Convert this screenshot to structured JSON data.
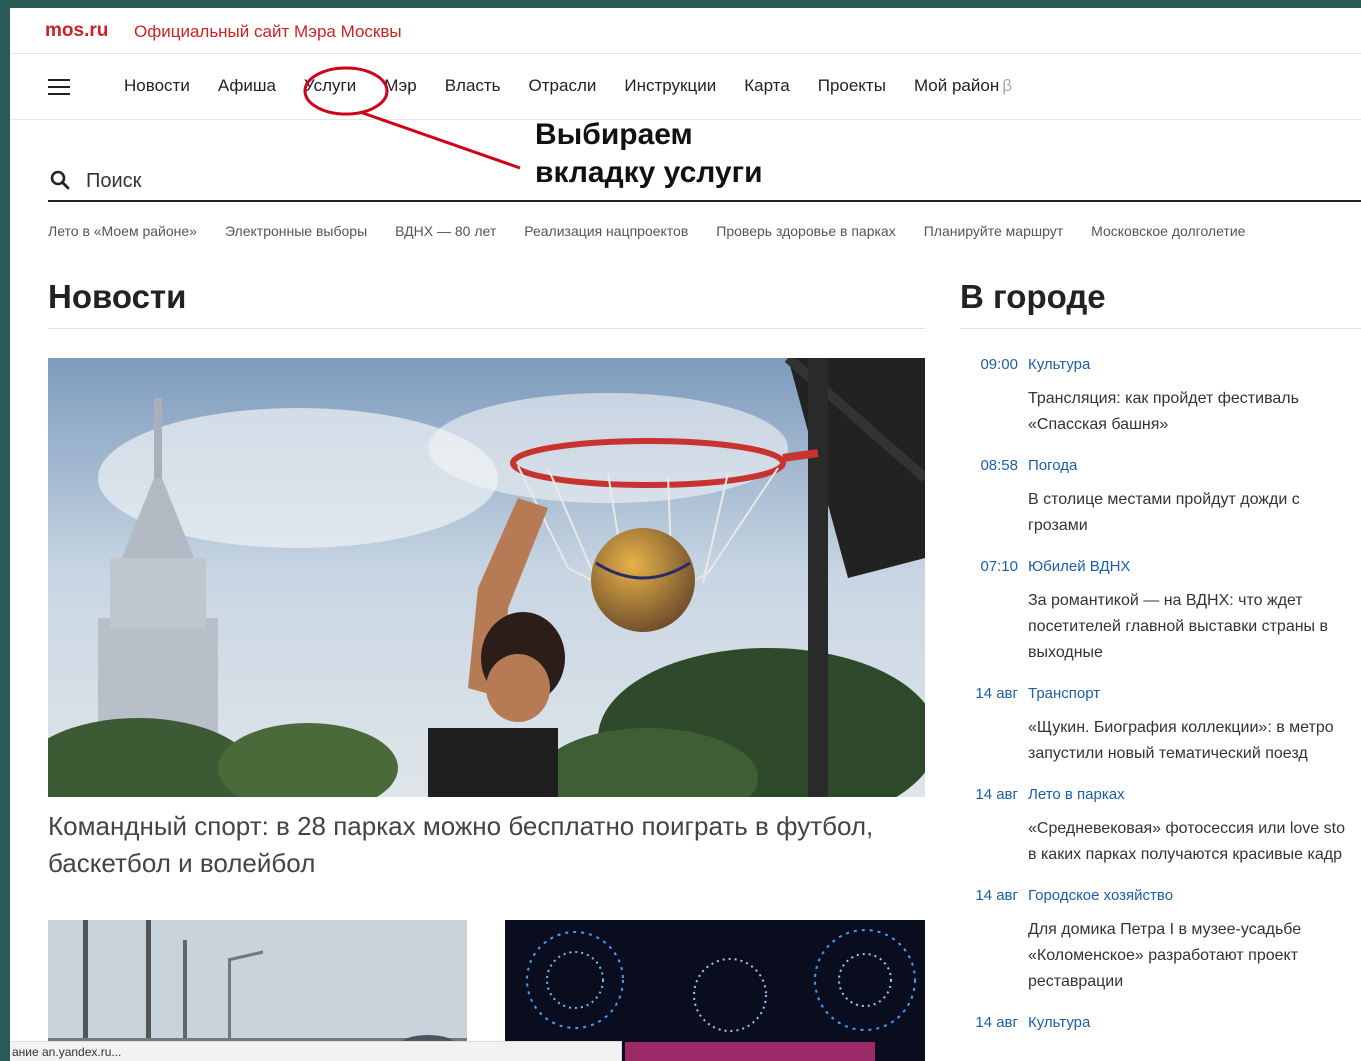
{
  "header": {
    "logo": "mos.ru",
    "site_title": "Официальный сайт Мэра Москвы"
  },
  "nav": {
    "items": [
      {
        "label": "Новости"
      },
      {
        "label": "Афиша"
      },
      {
        "label": "Услуги"
      },
      {
        "label": "Мэр"
      },
      {
        "label": "Власть"
      },
      {
        "label": "Отрасли"
      },
      {
        "label": "Инструкции"
      },
      {
        "label": "Карта"
      },
      {
        "label": "Проекты"
      },
      {
        "label": "Мой район",
        "suffix": "β"
      }
    ]
  },
  "annotation": {
    "line1": "Выбираем",
    "line2": "вкладку услуги",
    "color": "#d0021b"
  },
  "search": {
    "placeholder": "Поиск"
  },
  "quick_links": [
    "Лето в «Моем районе»",
    "Электронные выборы",
    "ВДНХ — 80 лет",
    "Реализация нацпроектов",
    "Проверь здоровье в парках",
    "Планируйте маршрут",
    "Московское долголетие"
  ],
  "news": {
    "title": "Новости",
    "hero_title": "Командный спорт: в 28 парках можно бесплатно поиграть в футбол, баскетбол и волейбол"
  },
  "city": {
    "title": "В городе",
    "items": [
      {
        "time": "09:00",
        "category": "Культура",
        "text": "Трансляция: как пройдет фестиваль\n«Спасская башня»"
      },
      {
        "time": "08:58",
        "category": "Погода",
        "text": "В столице местами пройдут дожди с\nгрозами"
      },
      {
        "time": "07:10",
        "category": "Юбилей ВДНХ",
        "text": "За романтикой — на ВДНХ: что ждет\nпосетителей главной выставки страны в\nвыходные"
      },
      {
        "time": "14 авг",
        "category": "Транспорт",
        "text": "«Щукин. Биография коллекции»: в метро\nзапустили новый тематический поезд"
      },
      {
        "time": "14 авг",
        "category": "Лето в парках",
        "text": "«Средневековая» фотосессия или love sto\nв каких парках получаются красивые кадр"
      },
      {
        "time": "14 авг",
        "category": "Городское хозяйство",
        "text": "Для домика Петра I в музее-усадьбе\n«Коломенское» разработают проект\nреставрации"
      },
      {
        "time": "14 авг",
        "category": "Культура",
        "text": ""
      }
    ]
  },
  "status_bar": {
    "text": "ание an.yandex.ru..."
  },
  "colors": {
    "brand_red": "#cc2222",
    "link_blue": "#1c5fa8"
  }
}
